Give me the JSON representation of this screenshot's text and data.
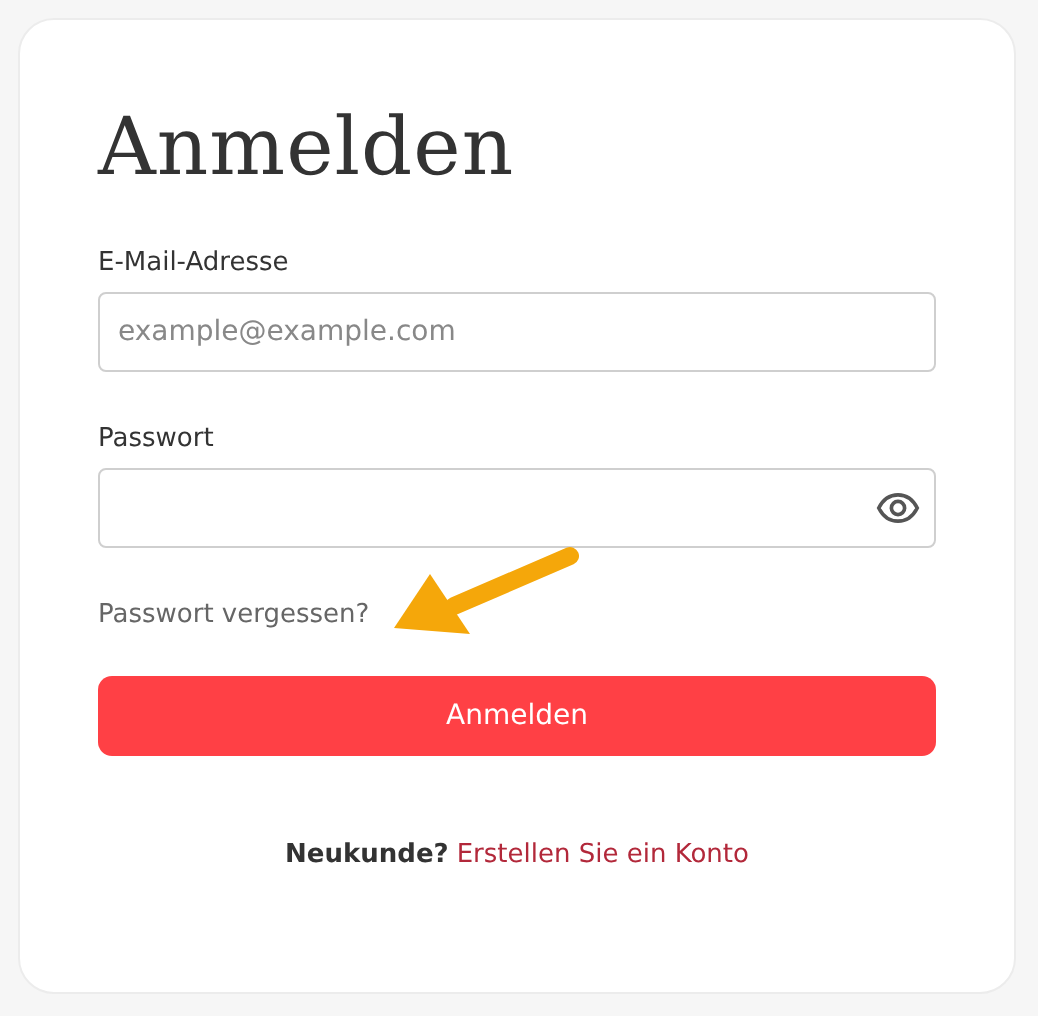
{
  "title": "Anmelden",
  "fields": [
    {
      "kind": "email",
      "label": "E-Mail-Adresse",
      "placeholder": "example@example.com"
    },
    {
      "kind": "password",
      "label": "Passwort"
    }
  ],
  "forgot_link": "Passwort vergessen?",
  "submit_button": "Anmelden",
  "signup": {
    "prompt": "Neukunde?",
    "link": "Erstellen Sie ein Konto"
  }
}
